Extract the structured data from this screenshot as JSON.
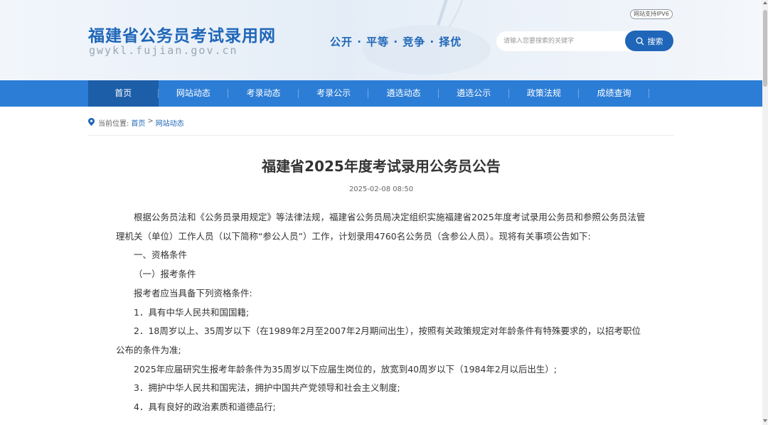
{
  "header": {
    "site_title": "福建省公务员考试录用网",
    "site_domain": "gwykl.fujian.gov.cn",
    "slogan": "公开 · 平等 · 竞争 · 择优",
    "ipv6_badge": "网站支持IPV6",
    "search": {
      "placeholder": "请输入您要搜索的关键字",
      "button_label": "搜索"
    }
  },
  "nav": {
    "items": [
      {
        "label": "首页"
      },
      {
        "label": "网站动态"
      },
      {
        "label": "考录动态"
      },
      {
        "label": "考录公示"
      },
      {
        "label": "遴选动态"
      },
      {
        "label": "遴选公示"
      },
      {
        "label": "政策法规"
      },
      {
        "label": "成绩查询"
      }
    ],
    "active_index": 0
  },
  "breadcrumb": {
    "prefix": "当前位置:",
    "home": "首页",
    "separator": ">",
    "current": "网站动态"
  },
  "article": {
    "title": "福建省2025年度考试录用公务员公告",
    "date": "2025-02-08 08:50",
    "paragraphs": [
      "根据公务员法和《公务员录用规定》等法律法规，福建省公务员局决定组织实施福建省2025年度考试录用公务员和参照公务员法管理机关（单位）工作人员（以下简称“参公人员”）工作，计划录用4760名公务员（含参公人员）。现将有关事项公告如下:",
      "一、资格条件",
      "（一）报考条件",
      "报考者应当具备下列资格条件:",
      "1．具有中华人民共和国国籍;",
      "2．18周岁以上、35周岁以下（在1989年2月至2007年2月期间出生），按照有关政策规定对年龄条件有特殊要求的，以招考职位公布的条件为准;",
      "2025年应届研究生报考年龄条件为35周岁以下应届生岗位的，放宽到40周岁以下（1984年2月以后出生）;",
      "3．拥护中华人民共和国宪法，拥护中国共产党领导和社会主义制度;",
      "4．具有良好的政治素质和道德品行;"
    ]
  },
  "colors": {
    "brand_blue": "#1f66b8",
    "nav_blue": "#2c7dd6",
    "nav_active": "#1c5ea8"
  }
}
